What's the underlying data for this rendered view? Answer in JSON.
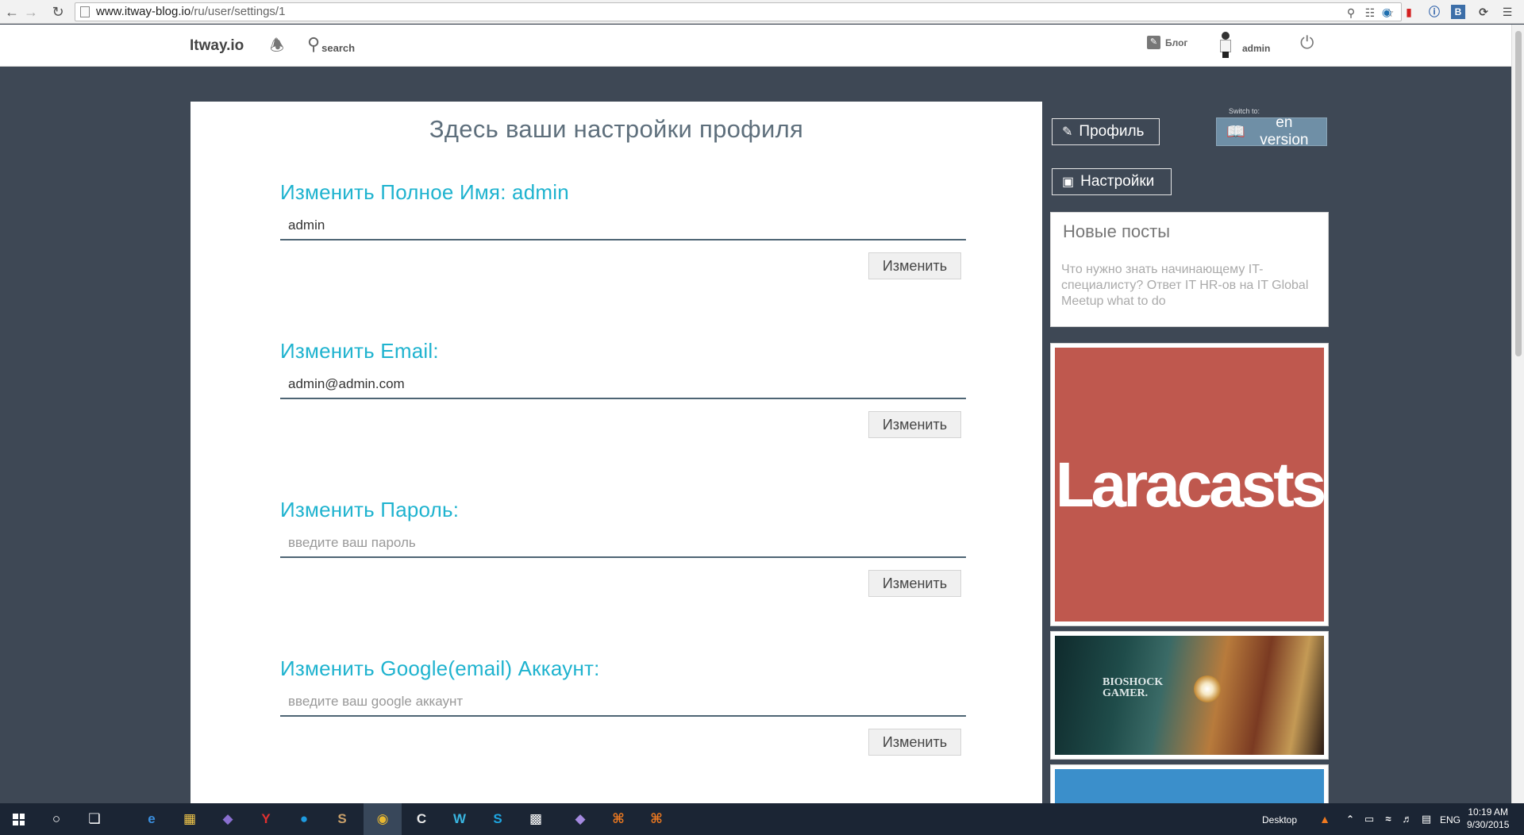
{
  "browser": {
    "url_host": "www.itway-blog.io",
    "url_path": "/ru/user/settings/1"
  },
  "header": {
    "logo": "Itway.io",
    "search_label": "search",
    "blog_label": "Блог",
    "user_name": "admin"
  },
  "main": {
    "page_title": "Здесь ваши настройки профиля",
    "sections": [
      {
        "title": "Изменить Полное Имя: admin",
        "value": "admin",
        "placeholder": "",
        "button": "Изменить"
      },
      {
        "title": "Изменить Email:",
        "value": "admin@admin.com",
        "placeholder": "",
        "button": "Изменить"
      },
      {
        "title": "Изменить Пароль:",
        "value": "",
        "placeholder": "введите ваш пароль",
        "button": "Изменить"
      },
      {
        "title": "Изменить Google(email) Аккаунт:",
        "value": "",
        "placeholder": "введите ваш google аккаунт",
        "button": "Изменить"
      }
    ]
  },
  "sidebar": {
    "profile_button": "Профиль",
    "switch_label": "Switch to:",
    "lang_button": "en version",
    "settings_button": "Настройки",
    "new_posts_title": "Новые посты",
    "new_post_link": "Что нужно знать начинающему IT-специалисту? Ответ IT HR-ов на IT Global Meetup what to do",
    "ad_laracasts": "Laracasts",
    "ad_bioshock_line1": "BIOSHOCK",
    "ad_bioshock_line2": "GAMER."
  },
  "taskbar": {
    "desktop_label": "Desktop",
    "language": "ENG",
    "time": "10:19 AM",
    "date": "9/30/2015"
  },
  "colors": {
    "background": "#3e4855",
    "accent_title": "#1fb3cf",
    "lang_button": "#6f8fa6",
    "laracasts": "#bf584e"
  }
}
